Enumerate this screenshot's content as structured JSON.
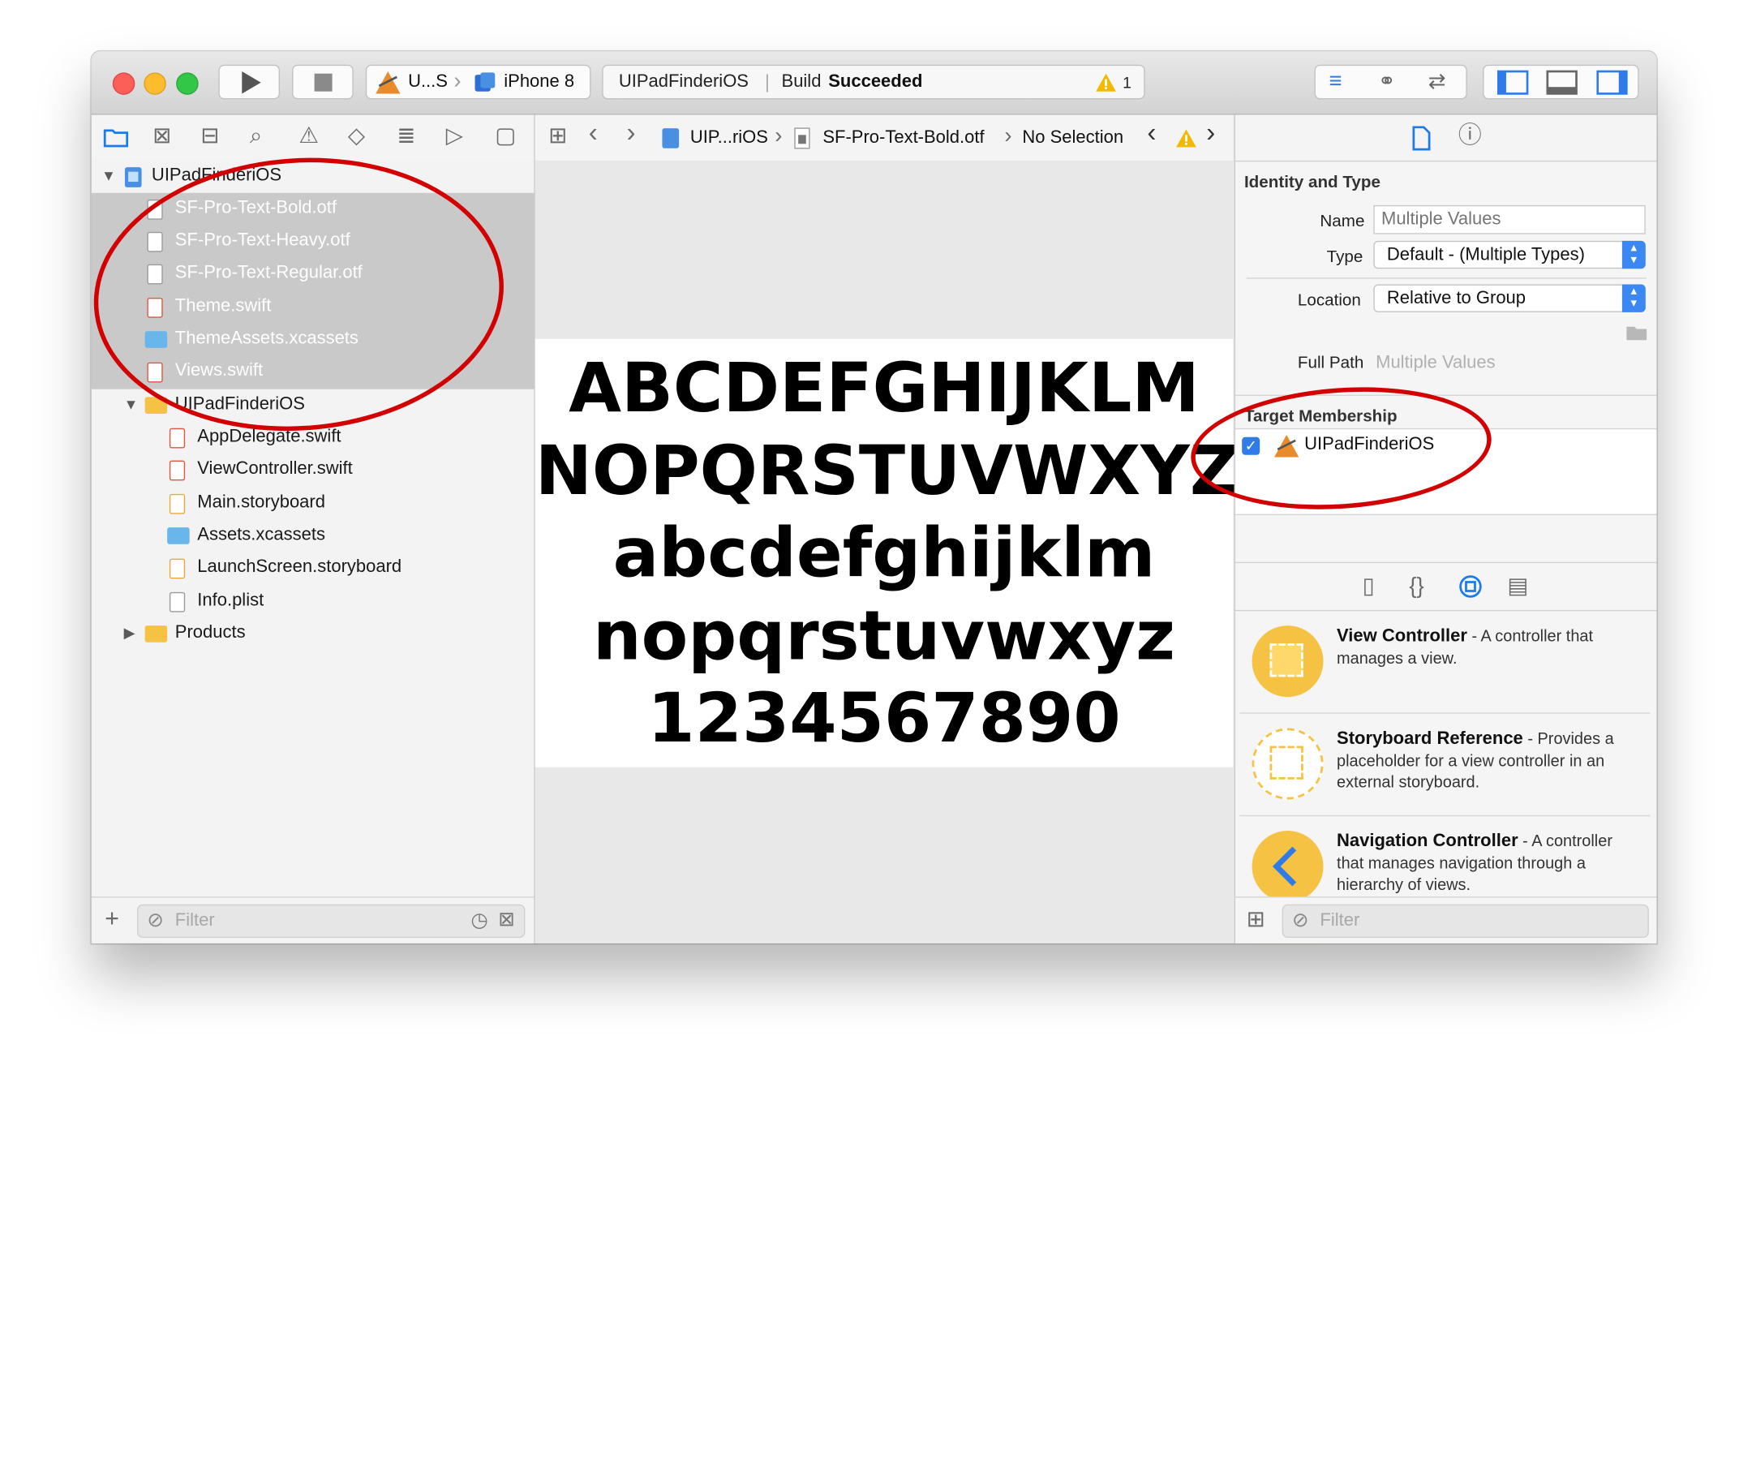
{
  "toolbar": {
    "scheme_name": "U...S",
    "device_name": "iPhone 8",
    "activity_project": "UIPadFinderiOS",
    "activity_build_prefix": "Build",
    "activity_build_status": "Succeeded",
    "warning_count": "1"
  },
  "jumpbar": {
    "crumb_project": "UIP...riOS",
    "crumb_file": "SF-Pro-Text-Bold.otf",
    "crumb_selection": "No Selection"
  },
  "navigator": {
    "project_root": "UIPadFinderiOS",
    "selected_files": [
      "SF-Pro-Text-Bold.otf",
      "SF-Pro-Text-Heavy.otf",
      "SF-Pro-Text-Regular.otf",
      "Theme.swift",
      "ThemeAssets.xcassets",
      "Views.swift"
    ],
    "group_name": "UIPadFinderiOS",
    "group_files": [
      "AppDelegate.swift",
      "ViewController.swift",
      "Main.storyboard",
      "Assets.xcassets",
      "LaunchScreen.storyboard",
      "Info.plist"
    ],
    "products": "Products",
    "filter_placeholder": "Filter"
  },
  "editor": {
    "glyph_lines": [
      "ABCDEFGHIJKLM",
      "NOPQRSTUVWXYZ",
      "abcdefghijklm",
      "nopqrstuvwxyz",
      "1234567890"
    ]
  },
  "inspector": {
    "section_identity": "Identity and Type",
    "name_label": "Name",
    "name_placeholder": "Multiple Values",
    "type_label": "Type",
    "type_value": "Default - (Multiple Types)",
    "location_label": "Location",
    "location_value": "Relative to Group",
    "fullpath_label": "Full Path",
    "fullpath_value": "Multiple Values",
    "section_target": "Target Membership",
    "target_name": "UIPadFinderiOS",
    "target_checked": true
  },
  "library": {
    "items": [
      {
        "title": "View Controller",
        "desc": " - A controller that manages a view."
      },
      {
        "title": "Storyboard Reference",
        "desc": " - Provides a placeholder for a view controller in an external storyboard."
      },
      {
        "title": "Navigation Controller",
        "desc": " - A controller that manages navigation through a hierarchy of views."
      }
    ],
    "filter_placeholder": "Filter"
  },
  "colors": {
    "selection_gray": "#c9c9c9",
    "accent_blue": "#1d7be8",
    "library_yellow": "#f6c244",
    "annotation_red": "#d20000",
    "warning_yellow": "#f3b800"
  }
}
